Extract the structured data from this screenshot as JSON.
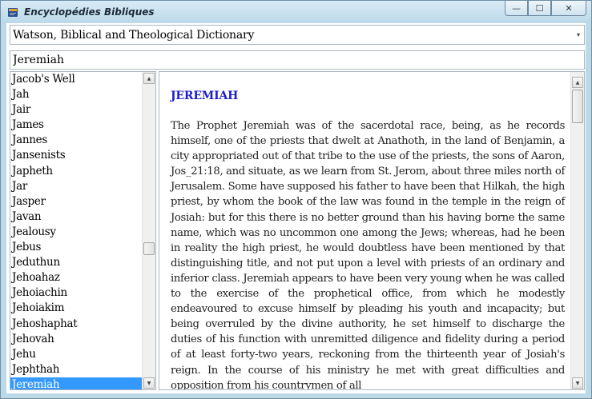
{
  "window": {
    "title": "Encyclopédies Bibliques",
    "minimize_glyph": "—",
    "maximize_glyph": "☐",
    "close_glyph": "✕"
  },
  "dictionary_select": {
    "selected": "Watson, Biblical and Theological Dictionary",
    "arrow_glyph": "▾"
  },
  "search": {
    "value": "Jeremiah"
  },
  "list": {
    "scroll_up_glyph": "▲",
    "scroll_down_glyph": "▼",
    "items": [
      {
        "label": "Jacob's Well"
      },
      {
        "label": "Jah"
      },
      {
        "label": "Jair"
      },
      {
        "label": "James"
      },
      {
        "label": "Jannes"
      },
      {
        "label": "Jansenists"
      },
      {
        "label": "Japheth"
      },
      {
        "label": "Jar"
      },
      {
        "label": "Jasper"
      },
      {
        "label": "Javan"
      },
      {
        "label": "Jealousy"
      },
      {
        "label": "Jebus"
      },
      {
        "label": "Jeduthun"
      },
      {
        "label": "Jehoahaz"
      },
      {
        "label": "Jehoiachin"
      },
      {
        "label": "Jehoiakim"
      },
      {
        "label": "Jehoshaphat"
      },
      {
        "label": "Jehovah"
      },
      {
        "label": "Jehu"
      },
      {
        "label": "Jephthah"
      },
      {
        "label": "Jeremiah"
      }
    ],
    "selected_index": 20
  },
  "article": {
    "title": "JEREMIAH",
    "body": "The Prophet Jeremiah was of the sacerdotal race, being, as he records himself, one of the priests that dwelt at Anathoth, in the land of Benjamin, a city appropriated out of that tribe to the use of the priests, the sons of Aaron, Jos_21:18, and situate, as we learn from St. Jerom, about three miles north of Jerusalem. Some have supposed his father to have been that Hilkah, the high priest, by whom the book of the law was found in the temple in the reign of Josiah: but for this there is no better ground than his having borne the same name, which was no uncommon one among the Jews; whereas, had he been in reality the high priest, he would doubtless have been mentioned by that distinguishing title, and not put upon a level with priests of an ordinary and inferior class. Jeremiah appears to have been very young when he was called to the exercise of the prophetical office, from which he modestly endeavoured to excuse himself by pleading his youth and incapacity; but being overruled by the divine authority, he set himself to discharge the duties of his function with unremitted diligence and fidelity during a period of at least forty-two years, reckoning from the thirteenth year of Josiah's reign. In the course of his ministry he met with great difficulties and opposition from his countrymen of all"
  },
  "colors": {
    "selection": "#3399ff",
    "title_blue": "#1d1dcc",
    "frame": "#bcd9e8"
  }
}
